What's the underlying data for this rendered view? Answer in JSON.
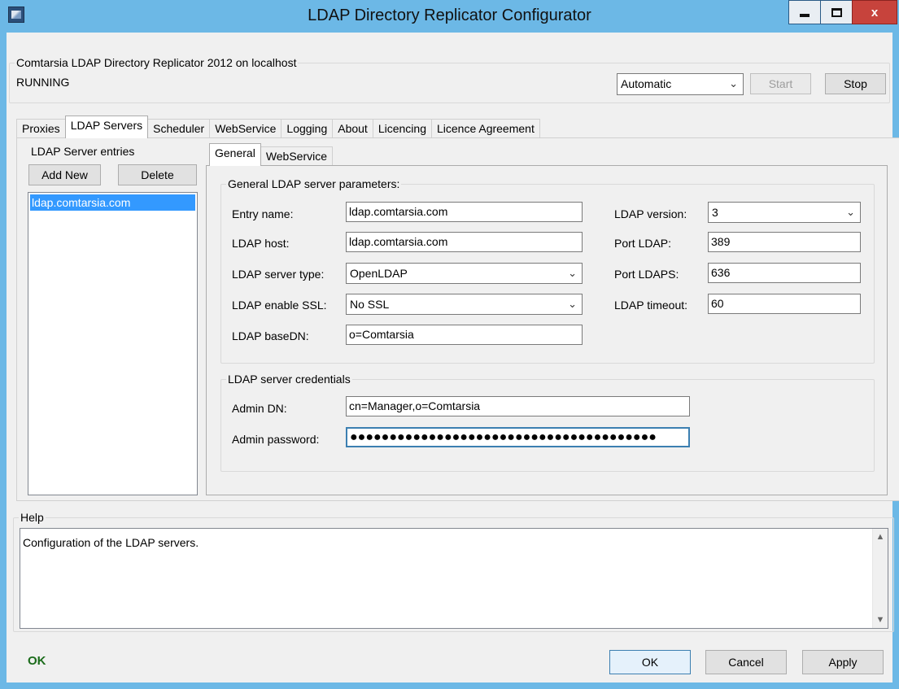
{
  "window": {
    "title": "LDAP Directory Replicator Configurator",
    "controls": {
      "minimize": "minimize",
      "maximize": "maximize",
      "close": "x"
    }
  },
  "service": {
    "group_title": "Comtarsia LDAP Directory Replicator 2012 on localhost",
    "status": "RUNNING",
    "startup_type": "Automatic",
    "start_label": "Start",
    "stop_label": "Stop"
  },
  "tabs": [
    "Proxies",
    "LDAP Servers",
    "Scheduler",
    "WebService",
    "Logging",
    "About",
    "Licencing",
    "Licence Agreement"
  ],
  "active_tab": "LDAP Servers",
  "server_entries": {
    "title": "LDAP Server entries",
    "add_label": "Add New",
    "delete_label": "Delete",
    "items": [
      "ldap.comtarsia.com"
    ]
  },
  "inner_tabs": [
    "General",
    "WebService"
  ],
  "general": {
    "group_title": "General LDAP server parameters:",
    "entry_name_label": "Entry name:",
    "entry_name_value": "ldap.comtarsia.com",
    "host_label": "LDAP host:",
    "host_value": "ldap.comtarsia.com",
    "server_type_label": "LDAP server type:",
    "server_type_value": "OpenLDAP",
    "ssl_label": "LDAP enable SSL:",
    "ssl_value": "No SSL",
    "basedn_label": "LDAP baseDN:",
    "basedn_value": "o=Comtarsia",
    "version_label": "LDAP version:",
    "version_value": "3",
    "port_label": "Port LDAP:",
    "port_value": "389",
    "ports_label": "Port LDAPS:",
    "ports_value": "636",
    "timeout_label": "LDAP timeout:",
    "timeout_value": "60"
  },
  "credentials": {
    "group_title": "LDAP server credentials",
    "admin_dn_label": "Admin DN:",
    "admin_dn_value": "cn=Manager,o=Comtarsia",
    "admin_password_label": "Admin password:",
    "admin_password_value": "●●●●●●●●●●●●●●●●●●●●●●●●●●●●●●●●●●●●●●●"
  },
  "help": {
    "group_title": "Help",
    "text": "Configuration of the LDAP servers."
  },
  "footer": {
    "status": "OK",
    "ok_label": "OK",
    "cancel_label": "Cancel",
    "apply_label": "Apply"
  }
}
